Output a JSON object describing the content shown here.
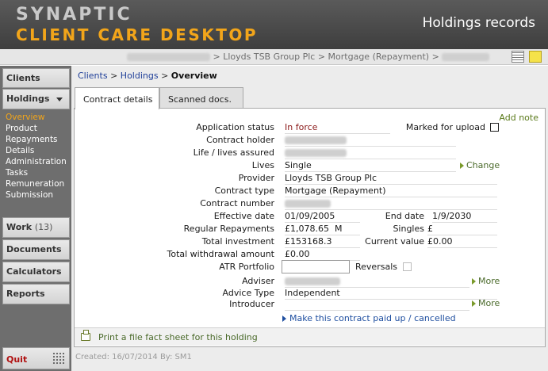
{
  "header": {
    "brand_line1": "SYNAPTIC",
    "brand_line2": "CLIENT CARE DESKTOP",
    "title": "Holdings records"
  },
  "topbar": {
    "path_sep1": " > ",
    "path_provider": "Lloyds TSB Group Plc",
    "path_sep2": " > ",
    "path_contract": "Mortgage (Repayment)",
    "path_sep3": " > "
  },
  "sidebar": {
    "clients": "Clients",
    "holdings": "Holdings",
    "holdings_submenu": [
      "Overview",
      "Product",
      "Repayments",
      "Details",
      "Administration",
      "Tasks",
      "Remuneration",
      "Submission"
    ],
    "work": "Work",
    "work_count": "(13)",
    "documents": "Documents",
    "calculators": "Calculators",
    "reports": "Reports",
    "quit": "Quit"
  },
  "breadcrumb": {
    "clients": "Clients",
    "sep": " > ",
    "holdings": "Holdings",
    "current": "Overview"
  },
  "tabs": [
    {
      "label": "Contract details",
      "active": true
    },
    {
      "label": "Scanned docs.",
      "active": false
    }
  ],
  "actions": {
    "add_note": "Add note",
    "change": "Change",
    "more": "More",
    "paid_up": "Make this contract paid up / cancelled",
    "fact_sheet": "Print a file fact sheet for this holding"
  },
  "labels": {
    "application_status": "Application status",
    "marked_for_upload": "Marked for upload",
    "contract_holder": "Contract holder",
    "lives_assured": "Life / lives assured",
    "lives": "Lives",
    "provider": "Provider",
    "contract_type": "Contract type",
    "contract_number": "Contract number",
    "effective_date": "Effective date",
    "end_date": "End date",
    "regular_repayments": "Regular Repayments",
    "singles": "Singles",
    "total_investment": "Total investment",
    "current_value": "Current value",
    "total_withdrawal": "Total withdrawal amount",
    "atr_portfolio": "ATR Portfolio",
    "reversals": "Reversals",
    "adviser": "Adviser",
    "advice_type": "Advice Type",
    "introducer": "Introducer"
  },
  "values": {
    "application_status": "In force",
    "lives": "Single",
    "provider": "Lloyds TSB Group Plc",
    "contract_type": "Mortgage (Repayment)",
    "effective_date": "01/09/2005",
    "end_date": "1/9/2030",
    "regular_repayments": "£1,078.65",
    "regular_repayments_freq": "M",
    "singles": "£",
    "total_investment": "£153168.3",
    "current_value": "£0.00",
    "total_withdrawal": "£0.00",
    "atr_portfolio": "",
    "advice_type": "Independent"
  },
  "footer": {
    "created": "Created: 16/07/2014 By: SM1"
  },
  "colors": {
    "brand_orange": "#f2a51a",
    "header_gray": "#4a4a4a",
    "status_red": "#8b1a1a",
    "link_blue": "#1f3f99",
    "action_green": "#4a6a2a"
  },
  "icons": [
    "grid-view-icon",
    "sticky-note-icon",
    "dropdown-arrow-icon",
    "printer-icon",
    "dots-grid-icon",
    "triangle-right-icon"
  ]
}
